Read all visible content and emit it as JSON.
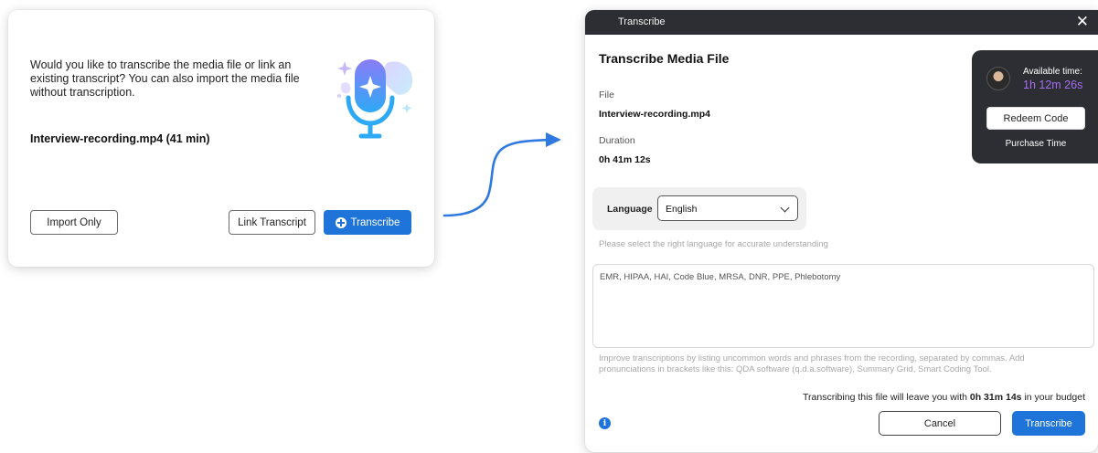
{
  "prompt_dialog": {
    "message": "Would you like to transcribe the media file or link an existing transcript? You can also import the media file without transcription.",
    "file_label": "Interview-recording.mp4 (41 min)",
    "illustration_icon": "microphone-sparkle-icon",
    "import_only_label": "Import Only",
    "link_transcript_label": "Link Transcript",
    "transcribe_label": "Transcribe",
    "transcribe_icon": "plus-circle-icon"
  },
  "transcribe_dialog": {
    "window_title": "Transcribe",
    "close_icon": "close-icon",
    "heading": "Transcribe Media File",
    "file_label": "File",
    "file_value": "Interview-recording.mp4",
    "duration_label": "Duration",
    "duration_value": "0h 41m 12s",
    "budget": {
      "available_label": "Available time:",
      "available_value": "1h 12m 26s",
      "redeem_label": "Redeem Code",
      "purchase_label": "Purchase Time"
    },
    "language": {
      "label": "Language",
      "selected": "English",
      "hint": "Please select the right language for accurate understanding"
    },
    "vocabulary": {
      "value": "EMR, HIPAA, HAI, Code Blue, MRSA, DNR, PPE, Phlebotomy",
      "hint_line1": "Improve transcriptions by listing uncommon words and phrases from the recording, separated by commas. Add",
      "hint_line2": "pronunciations in brackets like this: QDA software (q.d.a.software), Summary Grid, Smart Coding Tool."
    },
    "notice_prefix": "Transcribing this file will leave you with",
    "notice_value": "0h 31m 14s",
    "notice_suffix": "in your budget",
    "info_icon": "info-icon",
    "cancel_label": "Cancel",
    "transcribe_label": "Transcribe"
  },
  "colors": {
    "accent": "#1f74d9",
    "dark_panel": "#2c2e33",
    "available_time": "#a56df0"
  }
}
